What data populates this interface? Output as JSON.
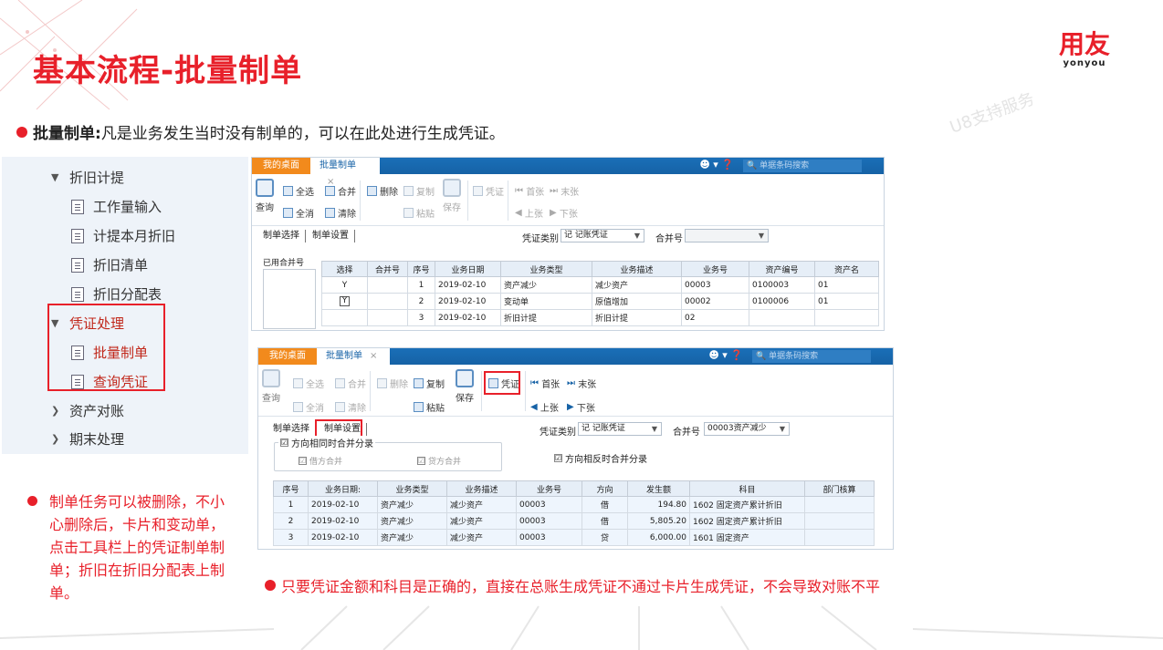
{
  "slide": {
    "title": "基本流程-批量制单",
    "logo_mark": "用友",
    "logo_sub": "yonyou",
    "watermark": "U8支持服务",
    "intro_bold": "批量制单:",
    "intro_text": "凡是业务发生当时没有制单的，可以在此处进行生成凭证。",
    "note_left": "制单任务可以被删除，不小心删除后，卡片和变动单，点击工具栏上的凭证制单制单；折旧在折旧分配表上制单。",
    "note_bottom": "只要凭证金额和科目是正确的，直接在总账生成凭证不通过卡片生成凭证，不会导致对账不平",
    "accent_color": "#e8202a"
  },
  "tree": {
    "items": [
      {
        "label": "折旧计提",
        "kind": "group-open"
      },
      {
        "label": "工作量输入",
        "kind": "doc"
      },
      {
        "label": "计提本月折旧",
        "kind": "doc"
      },
      {
        "label": "折旧清单",
        "kind": "doc"
      },
      {
        "label": "折旧分配表",
        "kind": "doc"
      },
      {
        "label": "凭证处理",
        "kind": "group-open"
      },
      {
        "label": "批量制单",
        "kind": "doc"
      },
      {
        "label": "查询凭证",
        "kind": "doc"
      },
      {
        "label": "资产对账",
        "kind": "group-closed"
      },
      {
        "label": "期末处理",
        "kind": "group-closed"
      }
    ]
  },
  "window": {
    "tab_home": "我的桌面",
    "tab_active": "批量制单",
    "tab_close": "×",
    "search_placeholder": "单据条码搜索",
    "toolbar": {
      "query": "查询",
      "select_all": "全选",
      "deselect_all": "全消",
      "merge": "合并",
      "clear": "清除",
      "delete": "删除",
      "copy": "复制",
      "paste": "粘贴",
      "save": "保存",
      "voucher": "凭证",
      "first": "首张",
      "last": "末张",
      "prev": "上张",
      "next": "下张"
    },
    "subtabs": [
      "制单选择",
      "制单设置"
    ],
    "voucher_type_label": "凭证类别",
    "voucher_type_value": "记 记账凭证",
    "merge_no_label": "合并号"
  },
  "window1": {
    "merged_label": "已用合并号",
    "merge_no_value": "",
    "columns": [
      "选择",
      "合并号",
      "序号",
      "业务日期",
      "业务类型",
      "业务描述",
      "业务号",
      "资产编号",
      "资产名"
    ],
    "rows": [
      [
        "Y",
        "",
        "1",
        "2019-02-10",
        "资产减少",
        "减少资产",
        "00003",
        "0100003",
        "01"
      ],
      [
        "Y",
        "",
        "2",
        "2019-02-10",
        "变动单",
        "原值增加",
        "00002",
        "0100006",
        "01"
      ],
      [
        "",
        "",
        "3",
        "2019-02-10",
        "折旧计提",
        "折旧计提",
        "02",
        "",
        ""
      ]
    ]
  },
  "window2": {
    "merge_no_value": "00003资产减少",
    "same_dir_label": "方向相同时合并分录",
    "debit_merge": "借方合并",
    "credit_merge": "贷方合并",
    "opposite_dir_label": "方向相反时合并分录",
    "check": "☑",
    "columns": [
      "序号",
      "业务日期:",
      "业务类型",
      "业务描述",
      "业务号",
      "方向",
      "发生额",
      "科目",
      "部门核算"
    ],
    "rows": [
      [
        "1",
        "2019-02-10",
        "资产减少",
        "减少资产",
        "00003",
        "借",
        "194.80",
        "1602  固定资产累计折旧",
        ""
      ],
      [
        "2",
        "2019-02-10",
        "资产减少",
        "减少资产",
        "00003",
        "借",
        "5,805.20",
        "1602  固定资产累计折旧",
        ""
      ],
      [
        "3",
        "2019-02-10",
        "资产减少",
        "减少资产",
        "00003",
        "贷",
        "6,000.00",
        "1601  固定资产",
        ""
      ]
    ]
  }
}
